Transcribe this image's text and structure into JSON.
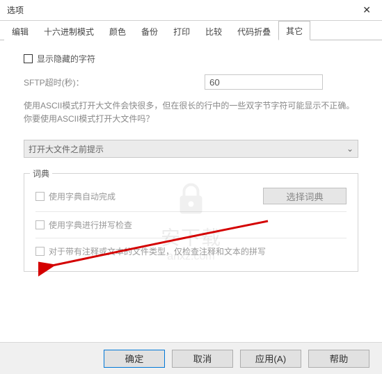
{
  "window": {
    "title": "选项"
  },
  "tabs": {
    "items": [
      {
        "label": "编辑"
      },
      {
        "label": "十六进制模式"
      },
      {
        "label": "颜色"
      },
      {
        "label": "备份"
      },
      {
        "label": "打印"
      },
      {
        "label": "比较"
      },
      {
        "label": "代码折叠"
      },
      {
        "label": "其它"
      }
    ],
    "activeIndex": 7
  },
  "opts": {
    "show_hidden_chars": "显示隐藏的字符",
    "sftp_label": "SFTP超时(秒)：",
    "sftp_value": "60",
    "ascii_desc": "使用ASCII模式打开大文件会快很多，但在很长的行中的一些双字节字符可能显示不正确。你要使用ASCII模式打开大文件吗？",
    "select_placeholder": "打开大文件之前提示"
  },
  "dict": {
    "legend": "词典",
    "use_auto": "使用字典自动完成",
    "select_btn": "选择词典",
    "use_spell": "使用字典进行拼写检查",
    "check_comments": "对于带有注释或文本的文件类型，仅检查注释和文本的拼写"
  },
  "footer": {
    "ok": "确定",
    "cancel": "取消",
    "apply": "应用(A)",
    "help": "帮助"
  },
  "watermark": {
    "line1": "安下载",
    "line2": "anxz.com"
  }
}
